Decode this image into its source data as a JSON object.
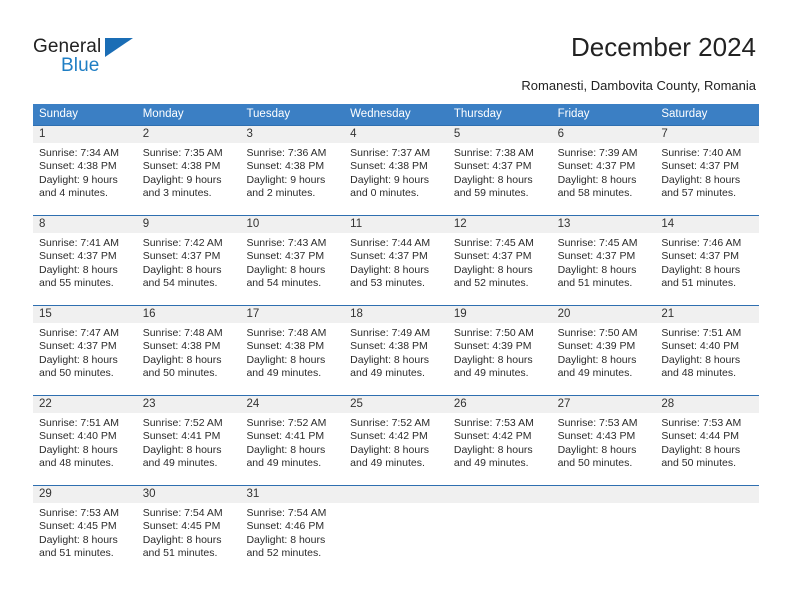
{
  "logo": {
    "primary_text": "General",
    "secondary_text": "Blue",
    "triangle_icon": "blue-triangle-icon",
    "primary_color": "#222222",
    "secondary_color": "#1f7ec4"
  },
  "header": {
    "title": "December 2024",
    "subtitle": "Romanesti, Dambovita County, Romania"
  },
  "theme": {
    "header_bg": "#3b7fc4",
    "header_text": "#ffffff",
    "date_strip_bg": "#f0f0f0",
    "rule_color": "#2f6fb0",
    "body_text": "#2b2b2b"
  },
  "calendar": {
    "weekday_headers": [
      "Sunday",
      "Monday",
      "Tuesday",
      "Wednesday",
      "Thursday",
      "Friday",
      "Saturday"
    ],
    "weeks": [
      {
        "dates": [
          "1",
          "2",
          "3",
          "4",
          "5",
          "6",
          "7"
        ],
        "cells": [
          {
            "lines": [
              "Sunrise: 7:34 AM",
              "Sunset: 4:38 PM",
              "Daylight: 9 hours",
              "and 4 minutes."
            ]
          },
          {
            "lines": [
              "Sunrise: 7:35 AM",
              "Sunset: 4:38 PM",
              "Daylight: 9 hours",
              "and 3 minutes."
            ]
          },
          {
            "lines": [
              "Sunrise: 7:36 AM",
              "Sunset: 4:38 PM",
              "Daylight: 9 hours",
              "and 2 minutes."
            ]
          },
          {
            "lines": [
              "Sunrise: 7:37 AM",
              "Sunset: 4:38 PM",
              "Daylight: 9 hours",
              "and 0 minutes."
            ]
          },
          {
            "lines": [
              "Sunrise: 7:38 AM",
              "Sunset: 4:37 PM",
              "Daylight: 8 hours",
              "and 59 minutes."
            ]
          },
          {
            "lines": [
              "Sunrise: 7:39 AM",
              "Sunset: 4:37 PM",
              "Daylight: 8 hours",
              "and 58 minutes."
            ]
          },
          {
            "lines": [
              "Sunrise: 7:40 AM",
              "Sunset: 4:37 PM",
              "Daylight: 8 hours",
              "and 57 minutes."
            ]
          }
        ]
      },
      {
        "dates": [
          "8",
          "9",
          "10",
          "11",
          "12",
          "13",
          "14"
        ],
        "cells": [
          {
            "lines": [
              "Sunrise: 7:41 AM",
              "Sunset: 4:37 PM",
              "Daylight: 8 hours",
              "and 55 minutes."
            ]
          },
          {
            "lines": [
              "Sunrise: 7:42 AM",
              "Sunset: 4:37 PM",
              "Daylight: 8 hours",
              "and 54 minutes."
            ]
          },
          {
            "lines": [
              "Sunrise: 7:43 AM",
              "Sunset: 4:37 PM",
              "Daylight: 8 hours",
              "and 54 minutes."
            ]
          },
          {
            "lines": [
              "Sunrise: 7:44 AM",
              "Sunset: 4:37 PM",
              "Daylight: 8 hours",
              "and 53 minutes."
            ]
          },
          {
            "lines": [
              "Sunrise: 7:45 AM",
              "Sunset: 4:37 PM",
              "Daylight: 8 hours",
              "and 52 minutes."
            ]
          },
          {
            "lines": [
              "Sunrise: 7:45 AM",
              "Sunset: 4:37 PM",
              "Daylight: 8 hours",
              "and 51 minutes."
            ]
          },
          {
            "lines": [
              "Sunrise: 7:46 AM",
              "Sunset: 4:37 PM",
              "Daylight: 8 hours",
              "and 51 minutes."
            ]
          }
        ]
      },
      {
        "dates": [
          "15",
          "16",
          "17",
          "18",
          "19",
          "20",
          "21"
        ],
        "cells": [
          {
            "lines": [
              "Sunrise: 7:47 AM",
              "Sunset: 4:37 PM",
              "Daylight: 8 hours",
              "and 50 minutes."
            ]
          },
          {
            "lines": [
              "Sunrise: 7:48 AM",
              "Sunset: 4:38 PM",
              "Daylight: 8 hours",
              "and 50 minutes."
            ]
          },
          {
            "lines": [
              "Sunrise: 7:48 AM",
              "Sunset: 4:38 PM",
              "Daylight: 8 hours",
              "and 49 minutes."
            ]
          },
          {
            "lines": [
              "Sunrise: 7:49 AM",
              "Sunset: 4:38 PM",
              "Daylight: 8 hours",
              "and 49 minutes."
            ]
          },
          {
            "lines": [
              "Sunrise: 7:50 AM",
              "Sunset: 4:39 PM",
              "Daylight: 8 hours",
              "and 49 minutes."
            ]
          },
          {
            "lines": [
              "Sunrise: 7:50 AM",
              "Sunset: 4:39 PM",
              "Daylight: 8 hours",
              "and 49 minutes."
            ]
          },
          {
            "lines": [
              "Sunrise: 7:51 AM",
              "Sunset: 4:40 PM",
              "Daylight: 8 hours",
              "and 48 minutes."
            ]
          }
        ]
      },
      {
        "dates": [
          "22",
          "23",
          "24",
          "25",
          "26",
          "27",
          "28"
        ],
        "cells": [
          {
            "lines": [
              "Sunrise: 7:51 AM",
              "Sunset: 4:40 PM",
              "Daylight: 8 hours",
              "and 48 minutes."
            ]
          },
          {
            "lines": [
              "Sunrise: 7:52 AM",
              "Sunset: 4:41 PM",
              "Daylight: 8 hours",
              "and 49 minutes."
            ]
          },
          {
            "lines": [
              "Sunrise: 7:52 AM",
              "Sunset: 4:41 PM",
              "Daylight: 8 hours",
              "and 49 minutes."
            ]
          },
          {
            "lines": [
              "Sunrise: 7:52 AM",
              "Sunset: 4:42 PM",
              "Daylight: 8 hours",
              "and 49 minutes."
            ]
          },
          {
            "lines": [
              "Sunrise: 7:53 AM",
              "Sunset: 4:42 PM",
              "Daylight: 8 hours",
              "and 49 minutes."
            ]
          },
          {
            "lines": [
              "Sunrise: 7:53 AM",
              "Sunset: 4:43 PM",
              "Daylight: 8 hours",
              "and 50 minutes."
            ]
          },
          {
            "lines": [
              "Sunrise: 7:53 AM",
              "Sunset: 4:44 PM",
              "Daylight: 8 hours",
              "and 50 minutes."
            ]
          }
        ]
      },
      {
        "dates": [
          "29",
          "30",
          "31",
          "",
          "",
          "",
          ""
        ],
        "cells": [
          {
            "lines": [
              "Sunrise: 7:53 AM",
              "Sunset: 4:45 PM",
              "Daylight: 8 hours",
              "and 51 minutes."
            ]
          },
          {
            "lines": [
              "Sunrise: 7:54 AM",
              "Sunset: 4:45 PM",
              "Daylight: 8 hours",
              "and 51 minutes."
            ]
          },
          {
            "lines": [
              "Sunrise: 7:54 AM",
              "Sunset: 4:46 PM",
              "Daylight: 8 hours",
              "and 52 minutes."
            ]
          },
          {
            "lines": [
              "",
              "",
              "",
              ""
            ]
          },
          {
            "lines": [
              "",
              "",
              "",
              ""
            ]
          },
          {
            "lines": [
              "",
              "",
              "",
              ""
            ]
          },
          {
            "lines": [
              "",
              "",
              "",
              ""
            ]
          }
        ]
      }
    ]
  }
}
